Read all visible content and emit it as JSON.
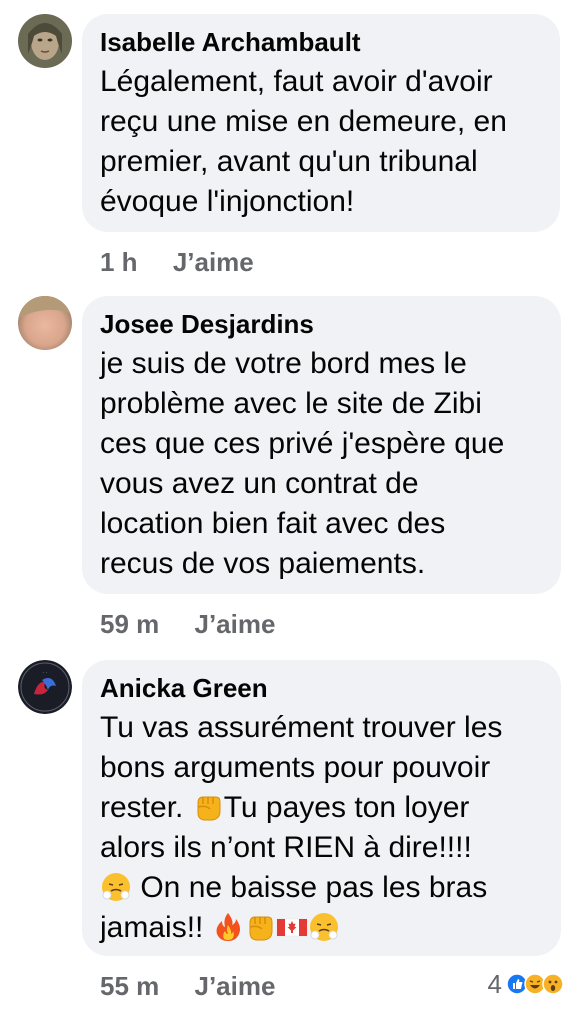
{
  "comments": [
    {
      "author": "Isabelle Archambault",
      "text": "Légalement, faut avoir d'avoir reçu une mise en demeure, en premier, avant qu'un tribunal évoque l'injonction!",
      "lines": [
        "Légalement, faut avoir d'avoir",
        "reçu une mise en demeure, en",
        "premier, avant qu'un tribunal",
        "évoque l'injonction!"
      ],
      "time": "1 h",
      "like_label": "J’aime",
      "avatar_icon": "portrait-avatar"
    },
    {
      "author": "Josee Desjardins",
      "lines": [
        "je suis de votre bord mes le",
        "problème avec le site de Zibi",
        "ces que ces privé j'espère que",
        "vous avez un contrat de",
        "location bien fait avec des",
        "recus de vos paiements."
      ],
      "time": "59 m",
      "like_label": "J’aime",
      "avatar_icon": "blurred-photo-avatar"
    },
    {
      "author": "Anicka Green",
      "line1": "Tu vas assurément trouver les",
      "line2": "bons arguments pour pouvoir",
      "line3a": "rester. ",
      "line3b": "Tu payes ton loyer",
      "line4": "alors ils n’ont RIEN à dire!!!!",
      "line5": " On ne baisse pas les bras",
      "line6a": "jamais!! ",
      "time": "55 m",
      "like_label": "J’aime",
      "reaction_count": "4",
      "emojis": [
        "raised-fist",
        "face-with-steam",
        "fire",
        "raised-fist",
        "canada-flag",
        "face-with-steam"
      ],
      "reaction_icons": [
        "like-reaction",
        "haha-reaction",
        "wow-reaction"
      ],
      "avatar_icon": "dark-logo-avatar"
    }
  ],
  "colors": {
    "bubble": "#f0f2f5",
    "meta": "#65676b",
    "like_blue": "#1877f2",
    "reaction_yellow": "#f7b125"
  }
}
